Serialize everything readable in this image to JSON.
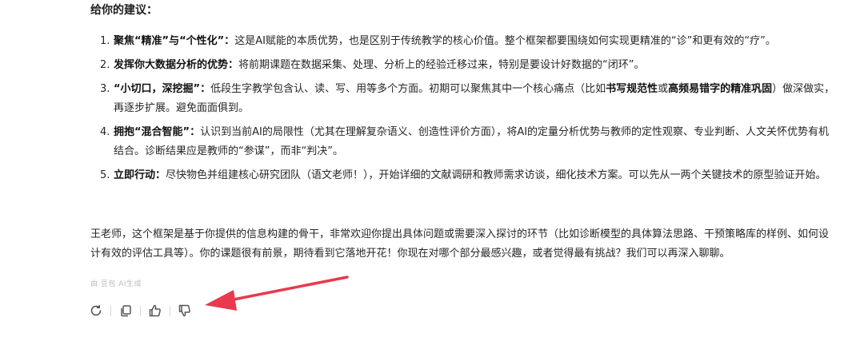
{
  "heading": "给你的建议：",
  "advice": [
    {
      "num": "1.",
      "parts": [
        {
          "b": true,
          "t": "聚焦“精准”与“个性化”："
        },
        {
          "b": false,
          "t": "这是AI赋能的本质优势，也是区别于传统教学的核心价值。整个框架都要围绕如何实现更精准的“诊”和更有效的“疗”。"
        }
      ]
    },
    {
      "num": "2.",
      "parts": [
        {
          "b": true,
          "t": "发挥你大数据分析的优势："
        },
        {
          "b": false,
          "t": "将前期课题在数据采集、处理、分析上的经验迁移过来，特别是要设计好数据的“闭环”。"
        }
      ]
    },
    {
      "num": "3.",
      "parts": [
        {
          "b": true,
          "t": "“小切口，深挖掘”："
        },
        {
          "b": false,
          "t": "低段生字教学包含认、读、写、用等多个方面。初期可以聚焦其中一个核心痛点（比如"
        },
        {
          "b": true,
          "t": "书写规范性"
        },
        {
          "b": false,
          "t": "或"
        },
        {
          "b": true,
          "t": "高频易错字的精准巩固"
        },
        {
          "b": false,
          "t": "）做深做实，再逐步扩展。避免面面俱到。"
        }
      ]
    },
    {
      "num": "4.",
      "parts": [
        {
          "b": true,
          "t": "拥抱“混合智能”："
        },
        {
          "b": false,
          "t": "认识到当前AI的局限性（尤其在理解复杂语义、创造性评价方面），将AI的定量分析优势与教师的定性观察、专业判断、人文关怀优势有机结合。诊断结果应是教师的“参谋”，而非“判决”。"
        }
      ]
    },
    {
      "num": "5.",
      "parts": [
        {
          "b": true,
          "t": "立即行动："
        },
        {
          "b": false,
          "t": "尽快物色并组建核心研究团队（语文老师！），开始详细的文献调研和教师需求访谈，细化技术方案。可以先从一两个关键技术的原型验证开始。"
        }
      ]
    }
  ],
  "closing": "王老师，这个框架是基于你提供的信息构建的骨干，非常欢迎你提出具体问题或需要深入探讨的环节（比如诊断模型的具体算法思路、干预策略库的样例、如何设计有效的评估工具等）。你的课题很有前景，期待看到它落地开花！你现在对哪个部分最感兴趣，或者觉得最有挑战？我们可以再深入聊聊。",
  "ai_note": "由 豆包 AI生成",
  "actions": [
    {
      "name": "regenerate-button",
      "icon": "refresh-icon"
    },
    {
      "name": "copy-button",
      "icon": "copy-icon"
    },
    {
      "name": "like-button",
      "icon": "thumbs-up-icon"
    },
    {
      "name": "dislike-button",
      "icon": "thumbs-down-icon"
    }
  ],
  "colors": {
    "arrow": "#e8394d",
    "text": "#262626",
    "icon": "#555555"
  }
}
